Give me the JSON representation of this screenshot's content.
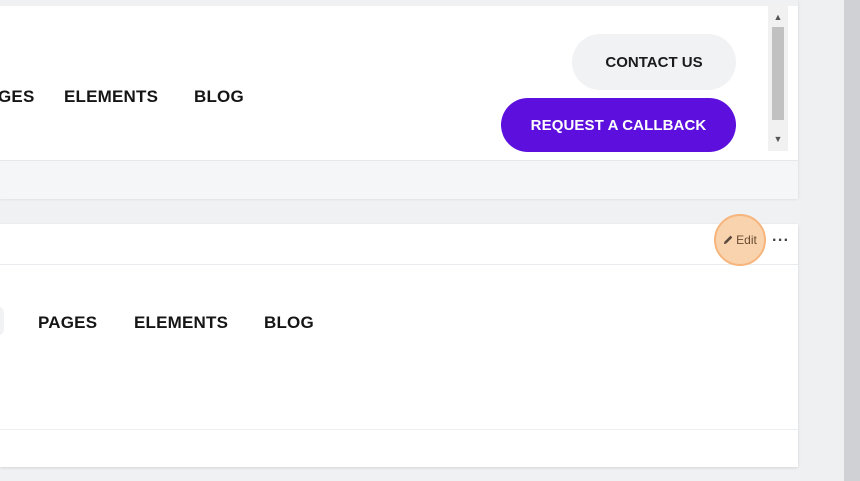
{
  "preview_top": {
    "nav": [
      "GES",
      "ELEMENTS",
      "BLOG"
    ],
    "contact_label": "CONTACT US",
    "callback_label": "REQUEST A CALLBACK"
  },
  "preview_bottom": {
    "nav": [
      "PAGES",
      "ELEMENTS",
      "BLOG"
    ]
  },
  "toolbar": {
    "edit_label": "Edit",
    "more_label": "···"
  },
  "colors": {
    "accent": "#5d10dd",
    "highlight": "#f9d3ad"
  }
}
